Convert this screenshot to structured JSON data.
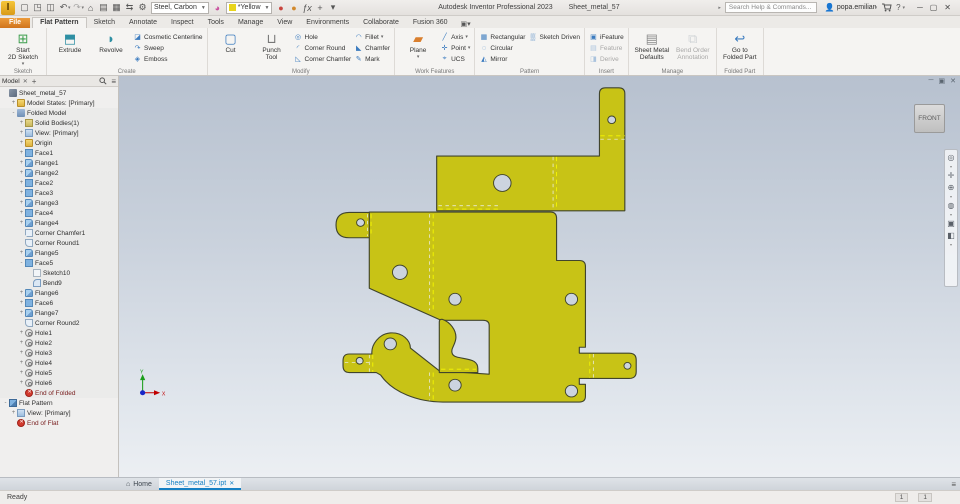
{
  "titlebar": {
    "app_title": "Autodesk Inventor Professional 2023",
    "doc_title": "Sheet_metal_57",
    "search_placeholder": "Search Help & Commands...",
    "user_name": "popa.emilian",
    "material_value": "Steel, Carbon",
    "appearance_value": "*Yellow",
    "appearance_swatch_color": "#e8d41c",
    "qat_icons": [
      "inventor-logo",
      "new-file-icon",
      "open-icon",
      "save-icon",
      "undo-icon",
      "redo-icon",
      "home-icon",
      "drawing-icon",
      "share-view-icon",
      "swap-icon",
      "gear-icon"
    ],
    "qat_right_icons": [
      "adjust-appearance-icon",
      "clear-appearance-icon",
      "fx-icon",
      "plus-icon",
      "qat-menu-icon"
    ],
    "window_controls": [
      "minimize",
      "maximize",
      "close"
    ]
  },
  "ribbon_tabs": {
    "items": [
      "File",
      "Flat Pattern",
      "Sketch",
      "Annotate",
      "Inspect",
      "Tools",
      "Manage",
      "View",
      "Environments",
      "Collaborate",
      "Fusion 360"
    ],
    "active": "Flat Pattern"
  },
  "ribbon_groups": [
    {
      "label": "Sketch",
      "big": [
        {
          "name": "start-2d-sketch",
          "lines": [
            "Start",
            "2D Sketch"
          ],
          "icon": "sketch-plus-icon",
          "color": "#3c9e4d",
          "dd": true
        }
      ],
      "cols": []
    },
    {
      "label": "Create",
      "big": [
        {
          "name": "extrude",
          "lines": [
            "Extrude"
          ],
          "icon": "extrude-icon",
          "color": "#2e8fa3"
        },
        {
          "name": "revolve",
          "lines": [
            "Revolve"
          ],
          "icon": "revolve-icon",
          "color": "#2e8fa3"
        }
      ],
      "cols": [
        [
          {
            "name": "cosmetic-centerline",
            "label": "Cosmetic Centerline",
            "icon": "centerline-icon"
          },
          {
            "name": "sweep",
            "label": "Sweep",
            "icon": "sweep-icon"
          },
          {
            "name": "emboss",
            "label": "Emboss",
            "icon": "emboss-icon"
          }
        ]
      ]
    },
    {
      "label": "Modify",
      "big": [
        {
          "name": "cut",
          "lines": [
            "Cut"
          ],
          "icon": "cut-icon",
          "color": "#3b7bbf"
        },
        {
          "name": "punch-tool",
          "lines": [
            "Punch",
            "Tool"
          ],
          "icon": "punch-icon",
          "color": "#777777"
        }
      ],
      "cols": [
        [
          {
            "name": "hole",
            "label": "Hole",
            "icon": "hole-icon"
          },
          {
            "name": "corner-round",
            "label": "Corner Round",
            "icon": "corner-round-icon"
          },
          {
            "name": "corner-chamfer",
            "label": "Corner Chamfer",
            "icon": "corner-chamfer-icon"
          }
        ],
        [
          {
            "name": "fillet",
            "label": "Fillet",
            "icon": "fillet-icon",
            "dd": true
          },
          {
            "name": "chamfer",
            "label": "Chamfer",
            "icon": "chamfer-icon"
          },
          {
            "name": "mark",
            "label": "Mark",
            "icon": "mark-icon"
          }
        ]
      ]
    },
    {
      "label": "Work Features",
      "big": [
        {
          "name": "plane",
          "lines": [
            "Plane"
          ],
          "icon": "plane-icon",
          "color": "#d97f2e",
          "dd": true
        }
      ],
      "cols": [
        [
          {
            "name": "axis",
            "label": "Axis",
            "icon": "axis-icon",
            "dd": true
          },
          {
            "name": "point",
            "label": "Point",
            "icon": "point-icon",
            "dd": true
          },
          {
            "name": "ucs",
            "label": "UCS",
            "icon": "ucs-icon"
          }
        ]
      ]
    },
    {
      "label": "Pattern",
      "big": [],
      "cols": [
        [
          {
            "name": "rectangular",
            "label": "Rectangular",
            "icon": "rectangular-pattern-icon"
          },
          {
            "name": "circular",
            "label": "Circular",
            "icon": "circular-pattern-icon"
          },
          {
            "name": "mirror",
            "label": "Mirror",
            "icon": "mirror-icon"
          }
        ],
        [
          {
            "name": "sketch-driven",
            "label": "Sketch Driven",
            "icon": "sketch-driven-icon"
          }
        ]
      ]
    },
    {
      "label": "Insert",
      "big": [],
      "cols": [
        [
          {
            "name": "ifeature",
            "label": "iFeature",
            "icon": "ifeature-icon"
          },
          {
            "name": "feature",
            "label": "Feature",
            "icon": "feature-icon",
            "disabled": true
          },
          {
            "name": "derive",
            "label": "Derive",
            "icon": "derive-icon",
            "disabled": true
          }
        ]
      ]
    },
    {
      "label": "Manage",
      "big": [
        {
          "name": "sheet-metal-defaults",
          "lines": [
            "Sheet Metal",
            "Defaults"
          ],
          "icon": "sheet-metal-defaults-icon",
          "color": "#8a8a8a"
        },
        {
          "name": "bend-order-annotation",
          "lines": [
            "Bend Order",
            "Annotation"
          ],
          "icon": "bend-order-icon",
          "color": "#9aa4ae",
          "disabled": true
        }
      ],
      "cols": []
    },
    {
      "label": "Folded Part",
      "big": [
        {
          "name": "go-to-folded-part",
          "lines": [
            "Go to",
            "Folded Part"
          ],
          "icon": "folded-part-icon",
          "color": "#3b7bbf"
        }
      ],
      "cols": []
    }
  ],
  "browser": {
    "tab_label": "Model",
    "tree": [
      {
        "level": 0,
        "exp": "",
        "icon": "part",
        "label": "Sheet_metal_57",
        "shade": false
      },
      {
        "level": 1,
        "exp": "+",
        "icon": "folder",
        "label": "Model States: [Primary]",
        "shade": false
      },
      {
        "level": 1,
        "exp": "-",
        "icon": "folded",
        "label": "Folded Model",
        "shade": true
      },
      {
        "level": 2,
        "exp": "+",
        "icon": "solid",
        "label": "Solid Bodies(1)",
        "shade": true
      },
      {
        "level": 2,
        "exp": "+",
        "icon": "view",
        "label": "View: [Primary]",
        "shade": true
      },
      {
        "level": 2,
        "exp": "+",
        "icon": "folder",
        "label": "Origin",
        "shade": true
      },
      {
        "level": 2,
        "exp": "+",
        "icon": "face",
        "label": "Face1",
        "shade": true
      },
      {
        "level": 2,
        "exp": "+",
        "icon": "flange",
        "label": "Flange1",
        "shade": true
      },
      {
        "level": 2,
        "exp": "+",
        "icon": "flange",
        "label": "Flange2",
        "shade": true
      },
      {
        "level": 2,
        "exp": "+",
        "icon": "face",
        "label": "Face2",
        "shade": true
      },
      {
        "level": 2,
        "exp": "+",
        "icon": "face",
        "label": "Face3",
        "shade": true
      },
      {
        "level": 2,
        "exp": "+",
        "icon": "flange",
        "label": "Flange3",
        "shade": true
      },
      {
        "level": 2,
        "exp": "+",
        "icon": "face",
        "label": "Face4",
        "shade": true
      },
      {
        "level": 2,
        "exp": "+",
        "icon": "flange",
        "label": "Flange4",
        "shade": true
      },
      {
        "level": 2,
        "exp": "",
        "icon": "chamfer",
        "label": "Corner Chamfer1",
        "shade": true
      },
      {
        "level": 2,
        "exp": "",
        "icon": "round",
        "label": "Corner Round1",
        "shade": true
      },
      {
        "level": 2,
        "exp": "+",
        "icon": "flange",
        "label": "Flange5",
        "shade": true
      },
      {
        "level": 2,
        "exp": "-",
        "icon": "face",
        "label": "Face5",
        "shade": true
      },
      {
        "level": 3,
        "exp": "",
        "icon": "sketch",
        "label": "Sketch10",
        "shade": true
      },
      {
        "level": 3,
        "exp": "",
        "icon": "bend",
        "label": "Bend9",
        "shade": true
      },
      {
        "level": 2,
        "exp": "+",
        "icon": "flange",
        "label": "Flange6",
        "shade": true
      },
      {
        "level": 2,
        "exp": "+",
        "icon": "face",
        "label": "Face6",
        "shade": true
      },
      {
        "level": 2,
        "exp": "+",
        "icon": "flange",
        "label": "Flange7",
        "shade": true
      },
      {
        "level": 2,
        "exp": "",
        "icon": "round",
        "label": "Corner Round2",
        "shade": true
      },
      {
        "level": 2,
        "exp": "+",
        "icon": "hole",
        "label": "Hole1",
        "shade": true
      },
      {
        "level": 2,
        "exp": "+",
        "icon": "hole",
        "label": "Hole2",
        "shade": true
      },
      {
        "level": 2,
        "exp": "+",
        "icon": "hole",
        "label": "Hole3",
        "shade": true
      },
      {
        "level": 2,
        "exp": "+",
        "icon": "hole",
        "label": "Hole4",
        "shade": true
      },
      {
        "level": 2,
        "exp": "+",
        "icon": "hole",
        "label": "Hole5",
        "shade": true
      },
      {
        "level": 2,
        "exp": "+",
        "icon": "hole",
        "label": "Hole6",
        "shade": true
      },
      {
        "level": 2,
        "exp": "",
        "icon": "end",
        "label": "End of Folded",
        "shade": true
      },
      {
        "level": 0,
        "exp": "-",
        "icon": "flat",
        "label": "Flat Pattern",
        "shade": false
      },
      {
        "level": 1,
        "exp": "+",
        "icon": "view",
        "label": "View: [Primary]",
        "shade": false
      },
      {
        "level": 1,
        "exp": "",
        "icon": "end",
        "label": "End of Flat",
        "shade": false
      }
    ]
  },
  "canvas": {
    "viewcube_label": "FRONT",
    "triad": {
      "x_label": "X",
      "y_label": "Y"
    },
    "part_fill": "#c8c316",
    "part_stroke": "#41452c",
    "bend_line_color": "#f6f800",
    "bend_line_alt_color": "#eef2f8",
    "nav_icons": [
      "navigation-wheel-icon",
      "pan-icon",
      "zoom-icon",
      "orbit-icon",
      "look-at-icon",
      "view-style-icon"
    ],
    "window_controls": [
      "minimize",
      "restore",
      "close"
    ]
  },
  "doctabs": {
    "home_label": "Home",
    "active_label": "Sheet_metal_57.ipt",
    "menu_icon": "tab-list-icon"
  },
  "statusbar": {
    "message": "Ready",
    "indicators": [
      "1",
      "1"
    ]
  }
}
